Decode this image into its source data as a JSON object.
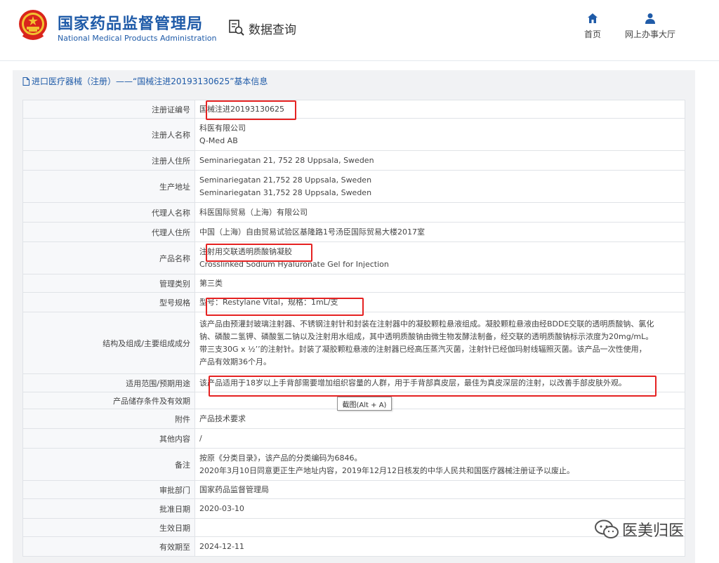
{
  "header": {
    "title_cn": "国家药品监督管理局",
    "title_en": "National Medical Products Administration",
    "data_query": "数据查询",
    "nav": {
      "home": "首页",
      "online_hall": "网上办事大厅"
    }
  },
  "breadcrumb": "进口医疗器械（注册）——“国械注进20193130625”基本信息",
  "rows": [
    {
      "label": "注册证编号",
      "values": [
        "国械注进20193130625"
      ]
    },
    {
      "label": "注册人名称",
      "values": [
        "科医有限公司",
        "Q-Med AB"
      ]
    },
    {
      "label": "注册人住所",
      "values": [
        "Seminariegatan 21, 752 28 Uppsala, Sweden"
      ]
    },
    {
      "label": "生产地址",
      "values": [
        "Seminariegatan 21,752 28 Uppsala, Sweden",
        "Seminariegatan 31,752 28 Uppsala, Sweden"
      ]
    },
    {
      "label": "代理人名称",
      "values": [
        "科医国际贸易（上海）有限公司"
      ]
    },
    {
      "label": "代理人住所",
      "values": [
        "中国（上海）自由贸易试验区基隆路1号汤臣国际贸易大楼2017室"
      ]
    },
    {
      "label": "产品名称",
      "values": [
        "注射用交联透明质酸钠凝胶",
        "Crosslinked Sodium Hyaluronate Gel for Injection"
      ]
    },
    {
      "label": "管理类别",
      "values": [
        "第三类"
      ]
    },
    {
      "label": "型号规格",
      "values": [
        "型号：Restylane Vital，规格：1mL/支"
      ]
    },
    {
      "label": "结构及组成/主要组成成分",
      "values": [
        "该产品由预灌封玻璃注射器、不锈钢注射针和封装在注射器中的凝胶颗粒悬液组成。凝胶颗粒悬液由经BDDE交联的透明质酸钠、氯化",
        "钠、磷酸二氢钾、磷酸氢二钠以及注射用水组成，其中透明质酸钠由微生物发酵法制备，经交联的透明质酸钠标示浓度为20mg/mL。",
        "带三支30G x ½’’的注射针。封装了凝胶颗粒悬液的注射器已经高压蒸汽灭菌，注射针已经伽玛射线辐照灭菌。该产品一次性使用，",
        "产品有效期36个月。"
      ]
    },
    {
      "label": "适用范围/预期用途",
      "values": [
        "该产品适用于18岁以上手背部需要增加组织容量的人群，用于手背部真皮层，最佳为真皮深层的注射，以改善手部皮肤外观。"
      ]
    },
    {
      "label": "产品储存条件及有效期",
      "values": [
        ""
      ]
    },
    {
      "label": "附件",
      "values": [
        "产品技术要求"
      ]
    },
    {
      "label": "其他内容",
      "values": [
        "/"
      ]
    },
    {
      "label": "备注",
      "values": [
        "按原《分类目录》，该产品的分类编码为6846。",
        "2020年3月10日同意更正生产地址内容，2019年12月12日核发的中华人民共和国医疗器械注册证予以废止。"
      ]
    },
    {
      "label": "审批部门",
      "values": [
        "国家药品监督管理局"
      ]
    },
    {
      "label": "批准日期",
      "values": [
        "2020-03-10"
      ]
    },
    {
      "label": "生效日期",
      "values": [
        ""
      ]
    },
    {
      "label": "有效期至",
      "values": [
        "2024-12-11"
      ]
    }
  ],
  "tooltip": "截图(Alt + A)",
  "watermark": "医美归医",
  "colors": {
    "brand_blue": "#1f5ba8",
    "highlight_red": "#e52222"
  }
}
